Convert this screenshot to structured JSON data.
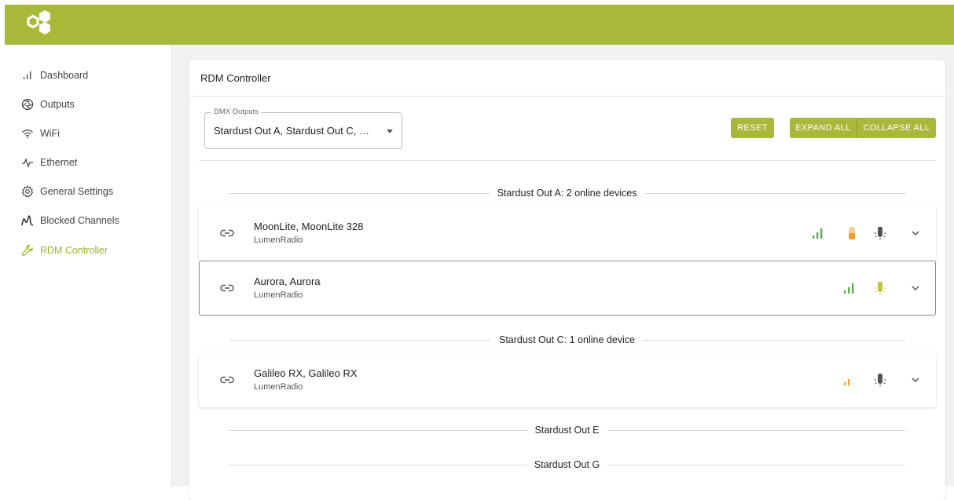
{
  "app": {
    "brand_color": "#a8b93a",
    "accent_active": "#9db230"
  },
  "sidebar": {
    "items": [
      {
        "label": "Dashboard",
        "icon": "signal-bars-icon"
      },
      {
        "label": "Outputs",
        "icon": "aperture-icon"
      },
      {
        "label": "WiFi",
        "icon": "wifi-icon"
      },
      {
        "label": "Ethernet",
        "icon": "pulse-icon"
      },
      {
        "label": "General Settings",
        "icon": "gear-icon"
      },
      {
        "label": "Blocked Channels",
        "icon": "waveform-icon"
      },
      {
        "label": "RDM Controller",
        "icon": "wrench-icon",
        "active": true
      }
    ]
  },
  "main": {
    "title": "RDM Controller",
    "dmx_select": {
      "label": "DMX Outputs",
      "value": "Stardust Out A, Stardust Out C, …"
    },
    "buttons": {
      "reset": "RESET",
      "expand_all": "EXPAND ALL",
      "collapse_all": "COLLAPSE ALL"
    },
    "groups": [
      {
        "header": "Stardust Out A: 2 online devices",
        "devices": [
          {
            "name": "MoonLite, MoonLite 328",
            "maker": "LumenRadio",
            "signal": "strong-green",
            "battery": "orange",
            "identify": "gray"
          },
          {
            "name": "Aurora, Aurora",
            "maker": "LumenRadio",
            "signal": "strong-green",
            "identify": "green"
          }
        ]
      },
      {
        "header": "Stardust Out C: 1 online device",
        "devices": [
          {
            "name": "Galileo RX, Galileo RX",
            "maker": "LumenRadio",
            "signal": "weak-orange",
            "identify": "gray"
          }
        ]
      },
      {
        "header": "Stardust Out E",
        "devices": []
      },
      {
        "header": "Stardust Out G",
        "devices": []
      }
    ]
  }
}
